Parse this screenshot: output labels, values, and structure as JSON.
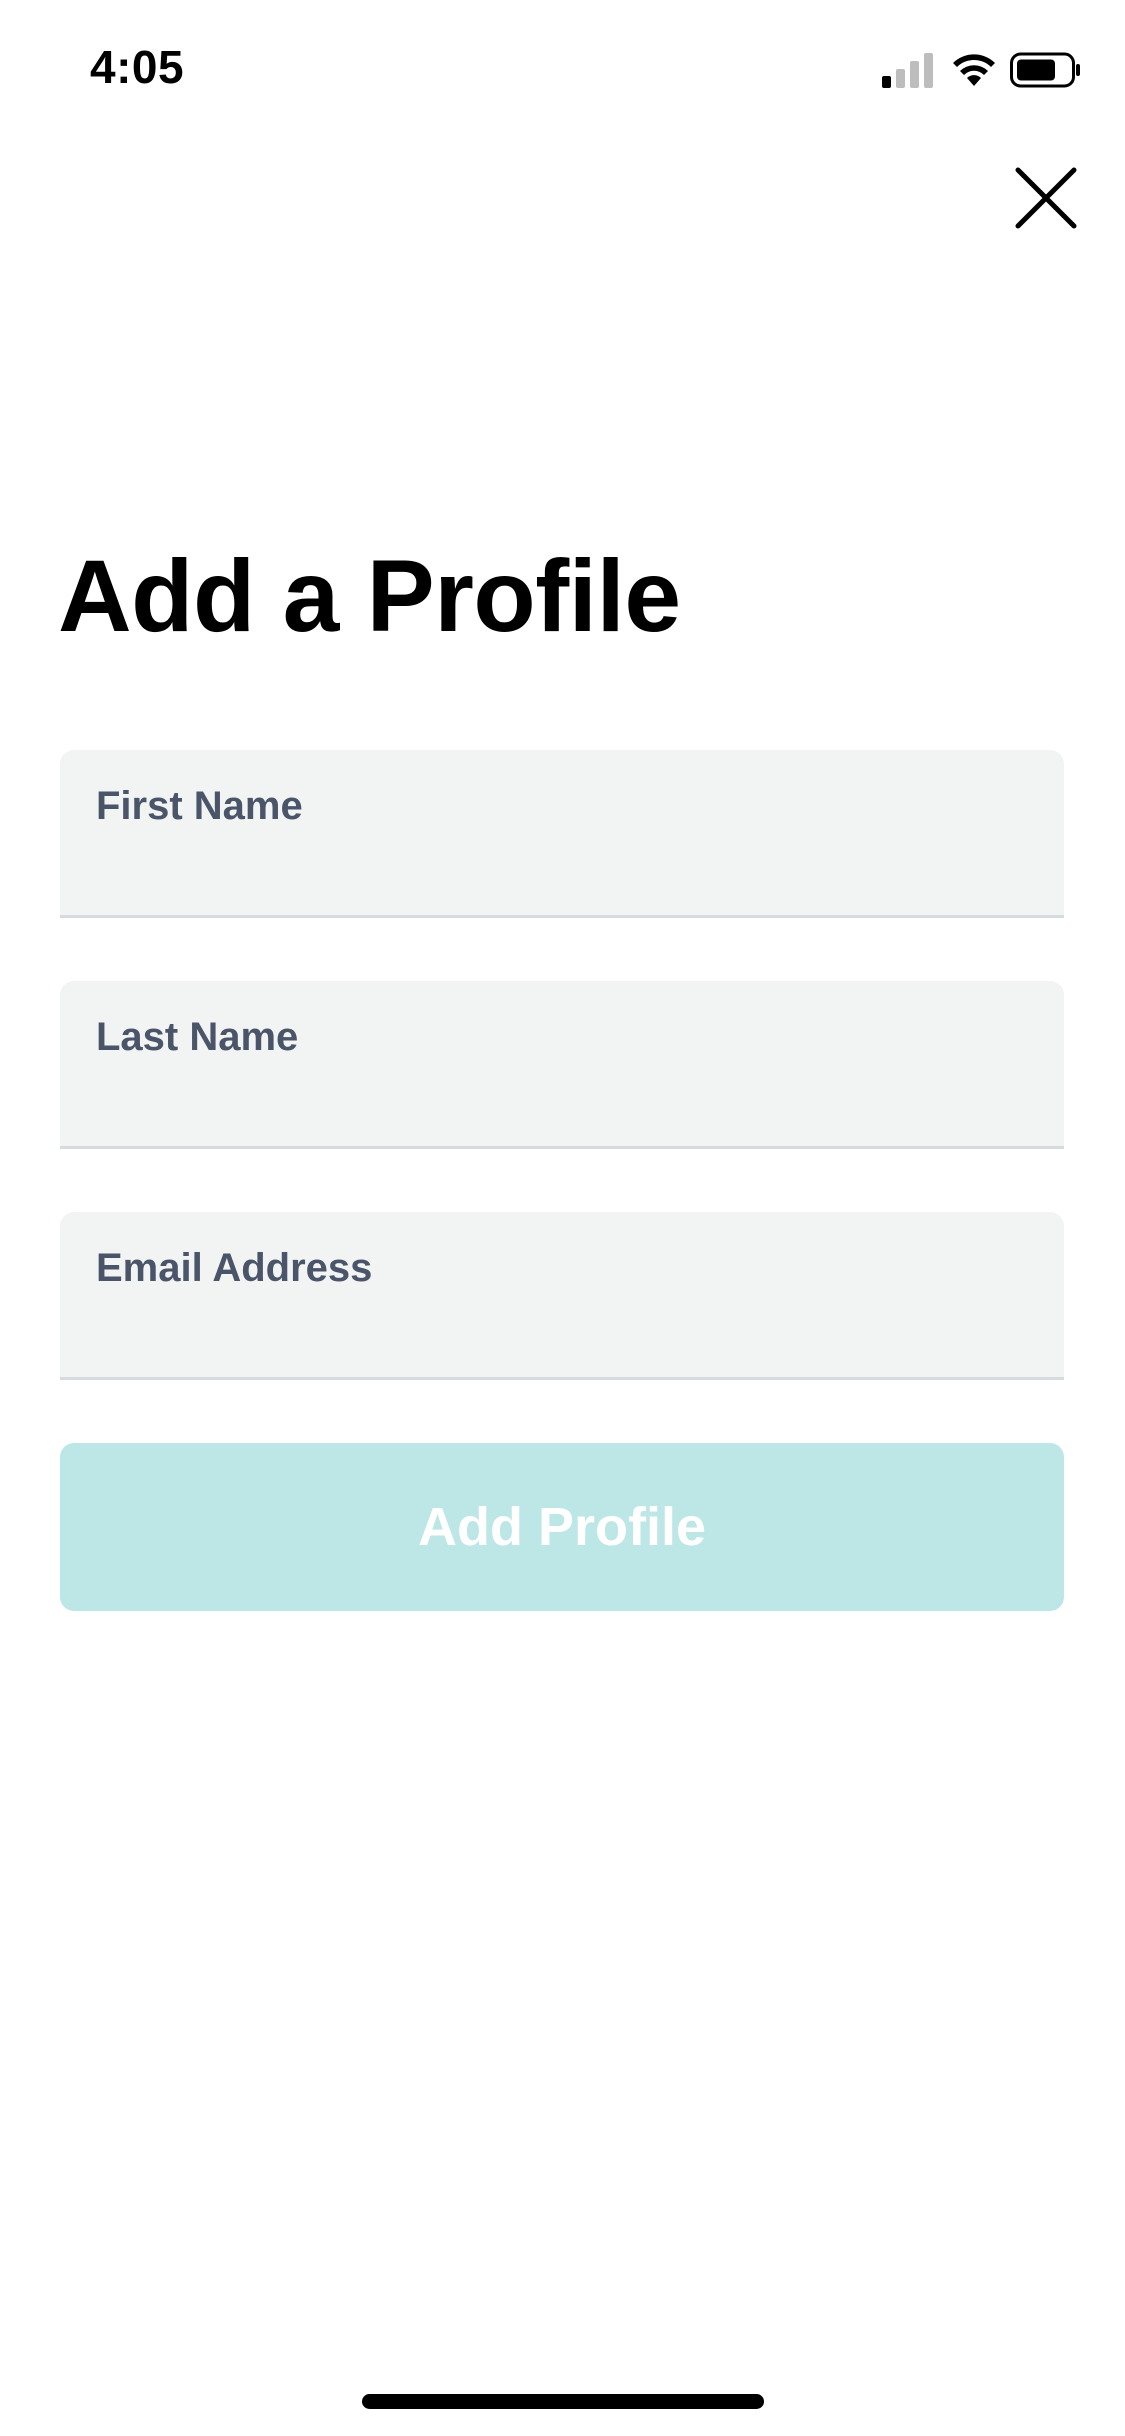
{
  "status_bar": {
    "time": "4:05",
    "signal_icon": "cellular-signal-icon",
    "wifi_icon": "wifi-icon",
    "battery_icon": "battery-icon"
  },
  "header": {
    "close_icon": "close-icon"
  },
  "title": "Add a Profile",
  "form": {
    "first_name": {
      "label": "First Name",
      "value": ""
    },
    "last_name": {
      "label": "Last Name",
      "value": ""
    },
    "email": {
      "label": "Email Address",
      "value": ""
    },
    "submit_label": "Add Profile"
  },
  "colors": {
    "field_background": "#f2f4f4",
    "field_label": "#4a5569",
    "button_background_disabled": "#bde6e6",
    "button_text": "#ffffff"
  }
}
